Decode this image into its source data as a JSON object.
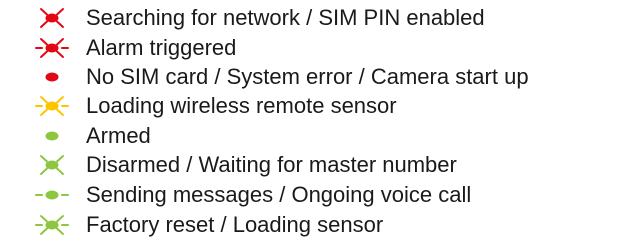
{
  "colors": {
    "red": "#e30613",
    "yellow": "#fdc500",
    "green": "#8dc63f",
    "text": "#1a1a1a"
  },
  "indicators": [
    {
      "pattern": "slow-blink",
      "color": "red",
      "label": "Searching for network / SIM PIN enabled"
    },
    {
      "pattern": "fast-blink",
      "color": "red",
      "label": "Alarm triggered"
    },
    {
      "pattern": "steady",
      "color": "red",
      "label": "No SIM  card / System error / Camera start up"
    },
    {
      "pattern": "fast-blink",
      "color": "yellow",
      "label": "Loading wireless remote sensor"
    },
    {
      "pattern": "steady",
      "color": "green",
      "label": "Armed"
    },
    {
      "pattern": "slow-blink",
      "color": "green",
      "label": "Disarmed / Waiting for master number"
    },
    {
      "pattern": "flash",
      "color": "green",
      "label": "Sending messages / Ongoing voice call"
    },
    {
      "pattern": "fast-blink",
      "color": "green",
      "label": "Factory reset / Loading sensor"
    }
  ]
}
